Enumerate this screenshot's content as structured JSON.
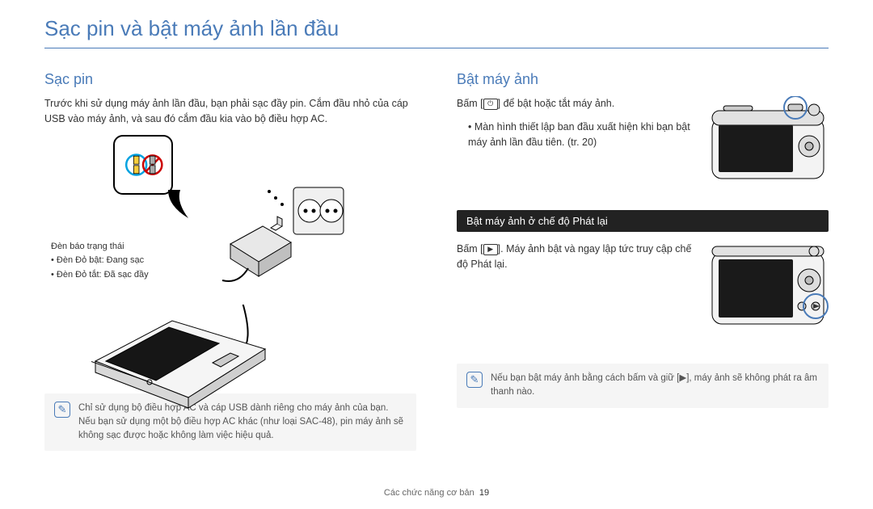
{
  "page_title": "Sạc pin và bật máy ảnh lần đầu",
  "left": {
    "heading": "Sạc pin",
    "intro": "Trước khi sử dụng máy ảnh lần đầu, bạn phải sạc đầy pin. Cắm đầu nhỏ của cáp USB vào máy ảnh, và sau đó cắm đầu kia vào bộ điều hợp AC.",
    "indicator_title": "Đèn báo trạng thái",
    "indicator_on": "Đèn Đỏ bật: Đang sạc",
    "indicator_off": "Đèn Đỏ tắt: Đã sạc đầy",
    "note": "Chỉ sử dụng bộ điều hợp AC và cáp USB dành riêng cho máy ảnh của bạn. Nếu bạn sử dụng một bộ điều hợp AC khác (như loại SAC-48), pin máy ảnh sẽ không sạc được hoặc không làm việc hiệu quả."
  },
  "right": {
    "heading": "Bật máy ảnh",
    "step1_a": "Bấm [",
    "step1_b": "] để bật hoặc tắt máy ảnh.",
    "step1_sub": "Màn hình thiết lập ban đầu xuất hiện khi bạn bật máy ảnh lần đầu tiên. (tr. 20)",
    "dark_heading": "Bật máy ảnh ở chế độ Phát lại",
    "step2_a": "Bấm [",
    "step2_b": "]. Máy ảnh bật và ngay lập tức truy cập chế độ Phát lại.",
    "note": "Nếu bạn bật máy ảnh bằng cách bấm và giữ [▶], máy ảnh sẽ không phát ra âm thanh nào."
  },
  "footer_label": "Các chức năng cơ bản",
  "page_number": "19"
}
